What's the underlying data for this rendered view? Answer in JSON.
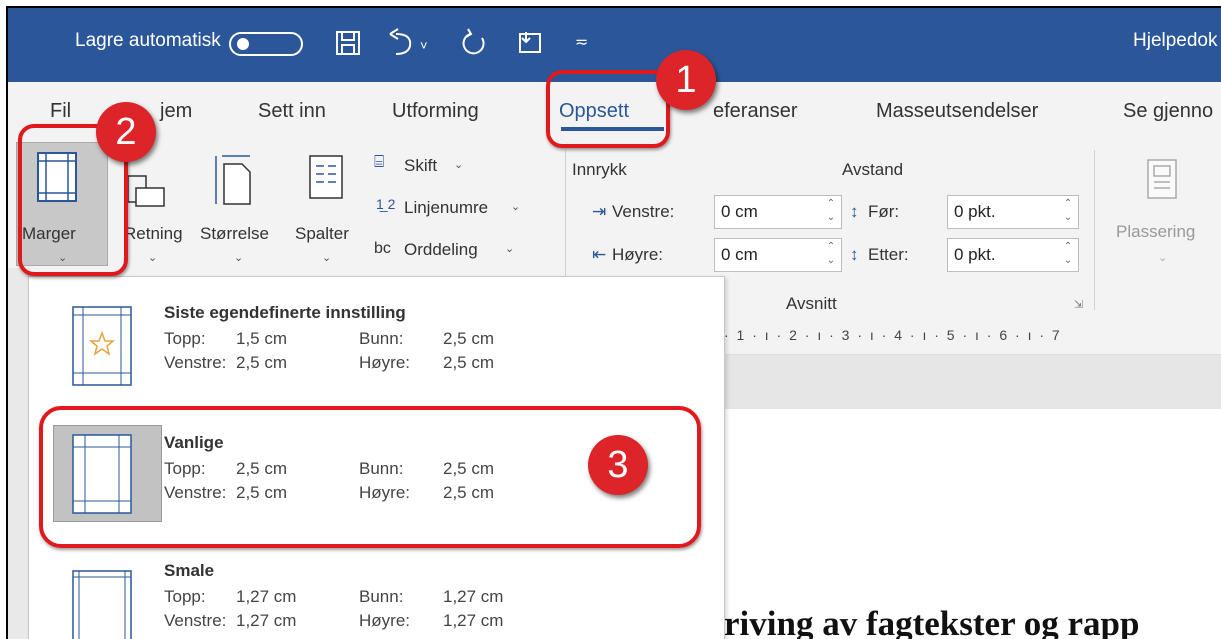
{
  "quick_access": {
    "autosave_label": "Lagre automatisk",
    "doc_title": "Hjelpedok",
    "icons": [
      "toggle-off",
      "save-icon",
      "undo-icon",
      "redo-icon",
      "touch-mode-icon",
      "customize-qat-icon"
    ]
  },
  "tabs": [
    "Fil",
    "Hjem",
    "Sett inn",
    "Utforming",
    "Oppsett",
    "Referanser",
    "Masseutsendelser",
    "Se gjennom"
  ],
  "tabs_visible": [
    "Fil",
    "jem",
    "Sett inn",
    "Utforming",
    "Oppsett",
    "eferanser",
    "Masseutsendelser",
    "Se gjenno"
  ],
  "active_tab": "Oppsett",
  "ribbon": {
    "marger_label": "Marger",
    "retning_label": "Retning",
    "storrelse_label": "Størrelse",
    "spalter_label": "Spalter",
    "skift_label": "Skift",
    "linjenumre_label": "Linjenumre",
    "orddeling_label": "Orddeling",
    "innrykk_label": "Innrykk",
    "avstand_label": "Avstand",
    "venstre_label": "Venstre:",
    "hoyre_label": "Høyre:",
    "for_label": "Før:",
    "etter_label": "Etter:",
    "venstre_value": "0 cm",
    "hoyre_value": "0 cm",
    "for_value": "0 pkt.",
    "etter_value": "0 pkt.",
    "avsnitt_label": "Avsnitt",
    "plassering_label": "Plassering"
  },
  "ruler": "· 1 · ı · 2 · ı · 3 · ı · 4 · ı · 5 · ı · 6 · ı · 7",
  "margins_menu": {
    "last_custom": {
      "title": "Siste egendefinerte innstilling",
      "topp": "Topp:",
      "topp_val": "1,5 cm",
      "bunn": "Bunn:",
      "bunn_val": "2,5 cm",
      "venstre": "Venstre:",
      "venstre_val": "2,5 cm",
      "hoyre": "Høyre:",
      "hoyre_val": "2,5 cm"
    },
    "normal": {
      "title": "Vanlige",
      "topp": "Topp:",
      "topp_val": "2,5 cm",
      "bunn": "Bunn:",
      "bunn_val": "2,5 cm",
      "venstre": "Venstre:",
      "venstre_val": "2,5 cm",
      "hoyre": "Høyre:",
      "hoyre_val": "2,5 cm"
    },
    "narrow": {
      "title": "Smale",
      "topp": "Topp:",
      "topp_val": "1,27 cm",
      "bunn": "Bunn:",
      "bunn_val": "1,27 cm",
      "venstre": "Venstre:",
      "venstre_val": "1,27 cm",
      "hoyre": "Høyre:",
      "hoyre_val": "1,27 cm"
    }
  },
  "document_heading": "riving av fagtekster og rapp",
  "callouts": [
    "1",
    "2",
    "3"
  ],
  "colors": {
    "title_bar": "#2b579a",
    "callout_red": "#e0191e",
    "selected_option": "#c2c2c2"
  }
}
